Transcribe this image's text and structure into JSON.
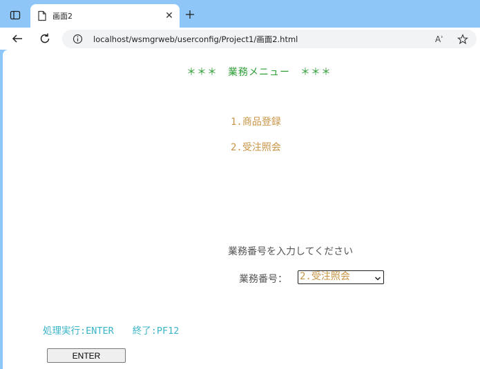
{
  "browser": {
    "tab": {
      "title": "画面2",
      "close_glyph": "✕"
    },
    "address_bar": {
      "url": "localhost/wsmgrweb/userconfig/Project1/画面2.html",
      "read_aloud_glyph": "Aʾ"
    }
  },
  "page": {
    "menu_title": "＊＊＊　業務メニュー　＊＊＊",
    "menu_items": [
      {
        "label": "1.商品登録"
      },
      {
        "label": "2.受注照会"
      }
    ],
    "prompt": "業務番号を入力してください",
    "job_field": {
      "label": "業務番号：",
      "selected_value": "2.受注照会"
    },
    "function_keys": "処理実行:ENTER　　終了:PF12",
    "enter_button_label": "ENTER"
  },
  "colors": {
    "title_green": "#2e9e36",
    "menu_orange": "#c99446",
    "function_cyan": "#3ab4c8",
    "tabstrip_blue": "#8ec7f7"
  }
}
